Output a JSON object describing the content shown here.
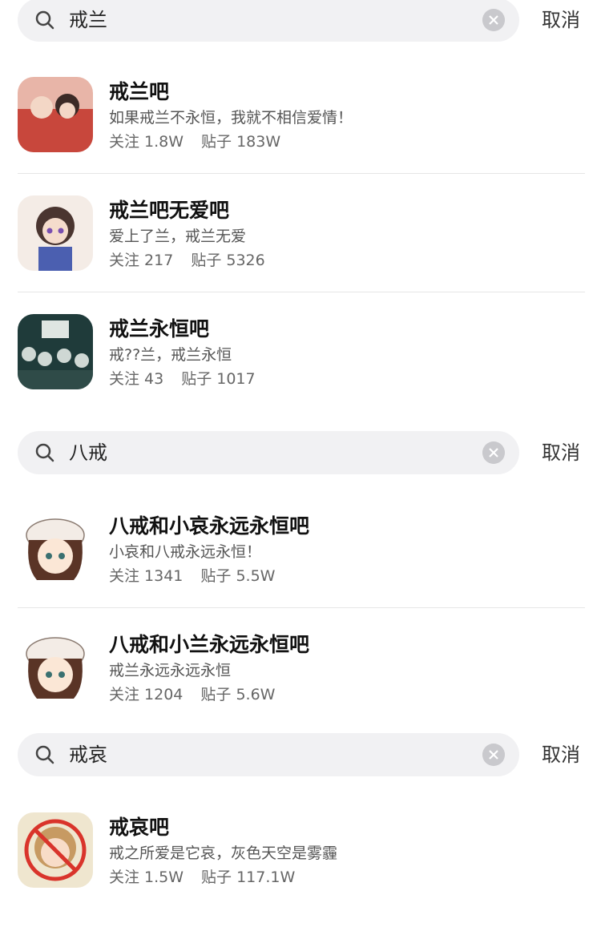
{
  "searches": [
    {
      "query": "戒兰",
      "cancel_label": "取消",
      "results": [
        {
          "title": "戒兰吧",
          "desc": "如果戒兰不永恒，我就不相信爱情！",
          "followers": "关注 1.8W",
          "posts": "贴子 183W"
        },
        {
          "title": "戒兰吧无爱吧",
          "desc": "爱上了兰，戒兰无爱",
          "followers": "关注 217",
          "posts": "贴子 5326"
        },
        {
          "title": "戒兰永恒吧",
          "desc": "戒??兰，戒兰永恒",
          "followers": "关注 43",
          "posts": "贴子 1017"
        }
      ]
    },
    {
      "query": "八戒",
      "cancel_label": "取消",
      "results": [
        {
          "title": "八戒和小哀永远永恒吧",
          "desc": "小哀和八戒永远永恒！",
          "followers": "关注 1341",
          "posts": "贴子 5.5W"
        },
        {
          "title": "八戒和小兰永远永恒吧",
          "desc": "戒兰永远永远永恒",
          "followers": "关注 1204",
          "posts": "贴子 5.6W"
        }
      ]
    },
    {
      "query": "戒哀",
      "cancel_label": "取消",
      "results": [
        {
          "title": "戒哀吧",
          "desc": "戒之所爱是它哀，灰色天空是雾霾",
          "followers": "关注 1.5W",
          "posts": "贴子 117.1W"
        }
      ]
    }
  ],
  "colors": {
    "search_bg": "#f1f1f3",
    "title": "#111111",
    "meta": "#666666"
  }
}
